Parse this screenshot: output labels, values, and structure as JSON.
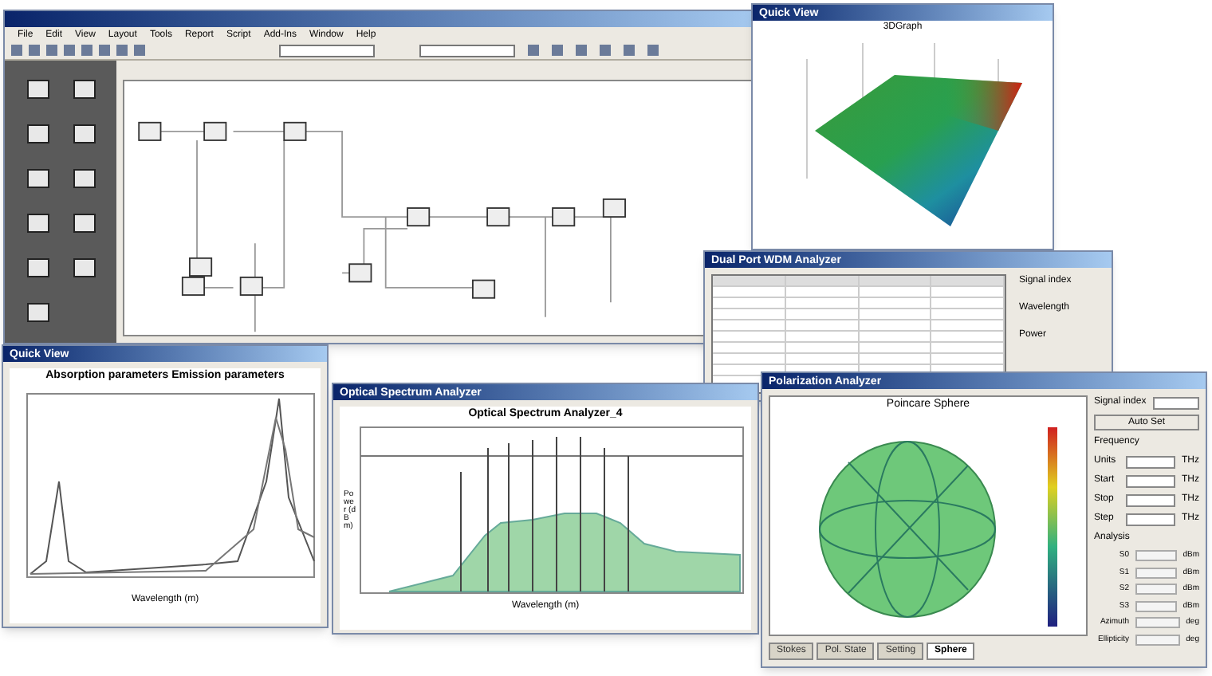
{
  "main_window": {
    "menu": [
      "File",
      "Edit",
      "View",
      "Layout",
      "Tools",
      "Report",
      "Script",
      "Add-Ins",
      "Window",
      "Help"
    ]
  },
  "surface_view": {
    "title": "Quick View",
    "chart_title": "3DGraph"
  },
  "wdm_analyzer": {
    "title": "Dual Port WDM Analyzer",
    "labels": [
      "Signal index",
      "Wavelength",
      "Power"
    ]
  },
  "absorption_view": {
    "title": "Quick View",
    "chart_title": "Absorption parameters Emission parameters",
    "xlabel": "Wavelength (m)"
  },
  "spectrum_analyzer": {
    "title": "Optical Spectrum Analyzer",
    "chart_title": "Optical Spectrum Analyzer_4",
    "xlabel": "Wavelength (m)",
    "ylabel": "Power (dBm)"
  },
  "polarization_analyzer": {
    "title": "Polarization Analyzer",
    "chart_title": "Poincare Sphere",
    "tabs": [
      {
        "label": "Stokes",
        "selected": false
      },
      {
        "label": "Pol. State",
        "selected": false
      },
      {
        "label": "Setting",
        "selected": false
      },
      {
        "label": "Sphere",
        "selected": true
      }
    ],
    "signal_index_label": "Signal index",
    "auto_set": "Auto Set",
    "frequency_group": "Frequency",
    "fields": [
      {
        "label": "Units",
        "unit": "THz"
      },
      {
        "label": "Start",
        "unit": "THz"
      },
      {
        "label": "Stop",
        "unit": "THz"
      },
      {
        "label": "Step",
        "unit": "THz"
      }
    ],
    "analysis_group": "Analysis",
    "analysis": [
      {
        "label": "S0",
        "unit": "dBm"
      },
      {
        "label": "S1",
        "unit": "dBm"
      },
      {
        "label": "S2",
        "unit": "dBm"
      },
      {
        "label": "S3",
        "unit": "dBm"
      },
      {
        "label": "Azimuth",
        "unit": "deg"
      },
      {
        "label": "Ellipticity",
        "unit": "deg"
      }
    ]
  }
}
